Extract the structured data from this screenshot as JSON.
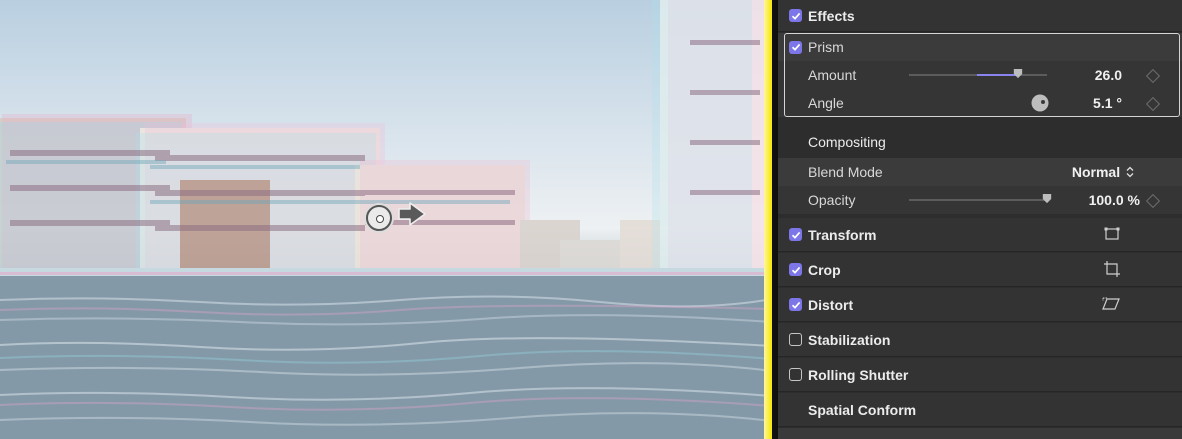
{
  "colors": {
    "accent": "#7d76e8",
    "panel_bg": "#2d2d2d",
    "frame_edge": "#f6e600"
  },
  "viewer": {
    "controls": {
      "center_control_icon": "target-circle-icon",
      "direction_icon": "arrow-right-icon"
    }
  },
  "inspector": {
    "effects": {
      "label": "Effects",
      "checked": true
    },
    "prism": {
      "label": "Prism",
      "checked": true,
      "amount": {
        "label": "Amount",
        "value": "26.0",
        "fraction": 0.79
      },
      "angle": {
        "label": "Angle",
        "value": "5.1",
        "unit": "°"
      }
    },
    "compositing": {
      "label": "Compositing",
      "blend_mode": {
        "label": "Blend Mode",
        "value": "Normal"
      },
      "opacity": {
        "label": "Opacity",
        "value": "100.0",
        "unit": "%",
        "fraction": 1.0
      }
    },
    "sections": [
      {
        "label": "Transform",
        "checked": true,
        "icon": "transform-icon"
      },
      {
        "label": "Crop",
        "checked": true,
        "icon": "crop-icon"
      },
      {
        "label": "Distort",
        "checked": true,
        "icon": "distort-icon"
      },
      {
        "label": "Stabilization",
        "checked": false
      },
      {
        "label": "Rolling Shutter",
        "checked": false
      },
      {
        "label": "Spatial Conform"
      }
    ]
  }
}
